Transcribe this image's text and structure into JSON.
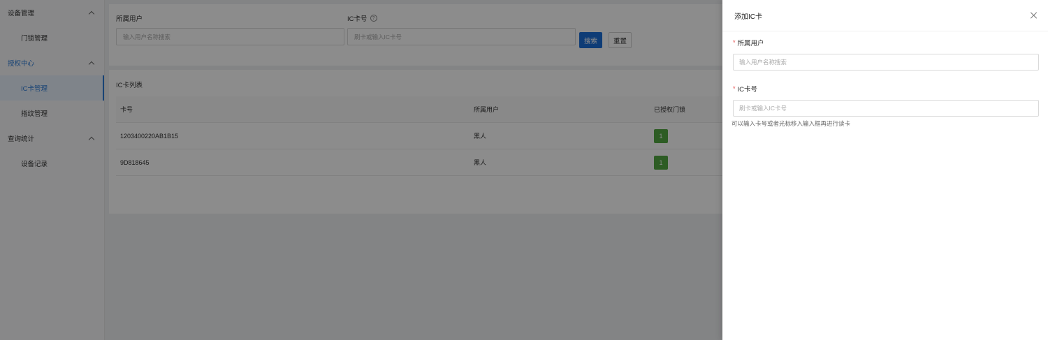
{
  "sidebar": {
    "groups": [
      {
        "label": "设备管理",
        "items": [
          {
            "label": "门锁管理"
          }
        ]
      },
      {
        "label": "授权中心",
        "items": [
          {
            "label": "IC卡管理"
          },
          {
            "label": "指纹管理"
          }
        ]
      },
      {
        "label": "查询统计",
        "items": [
          {
            "label": "设备记录"
          }
        ]
      }
    ]
  },
  "search": {
    "user_label": "所属用户",
    "user_placeholder": "输入用户名称搜索",
    "card_label": "IC卡号",
    "card_placeholder": "刷卡或输入IC卡号",
    "search_button": "搜索",
    "reset_button": "重置"
  },
  "list": {
    "title": "IC卡列表",
    "columns": [
      "卡号",
      "所属用户",
      "已授权门锁"
    ],
    "rows": [
      {
        "card": "1203400220AB1B15",
        "user": "黑人",
        "locks": "1"
      },
      {
        "card": "9D818645",
        "user": "黑人",
        "locks": "1"
      }
    ]
  },
  "drawer": {
    "title": "添加IC卡",
    "user_label": "所属用户",
    "user_placeholder": "输入用户名称搜索",
    "card_label": "IC卡号",
    "card_placeholder": "刷卡或输入IC卡号",
    "required_mark": "*",
    "hint": "可以输入卡号或者光标移入输入框再进行读卡"
  },
  "colors": {
    "primary": "#1a6ed8",
    "active_menu": "#2d7bd6",
    "badge_green": "#52a842",
    "required_red": "#e54545"
  }
}
